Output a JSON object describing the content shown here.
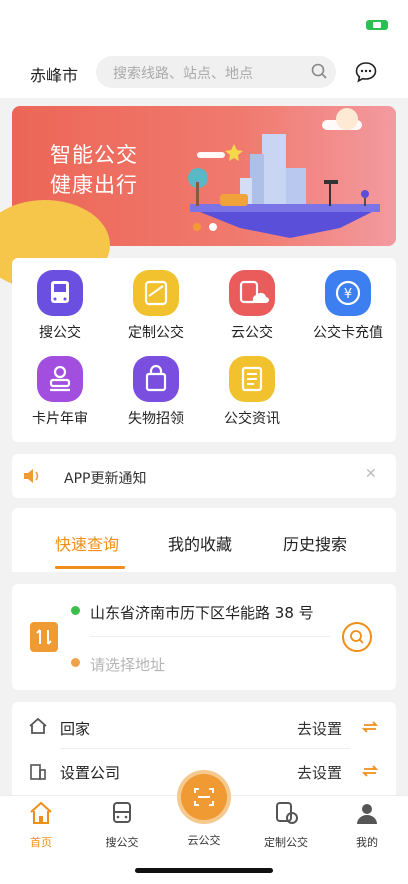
{
  "header": {
    "city": "赤峰市",
    "search_placeholder": "搜索线路、站点、地点"
  },
  "banner": {
    "line1": "智能公交",
    "line2": "健康出行"
  },
  "features": [
    {
      "label": "搜公交",
      "icon": "bus-icon",
      "color": "#6b4fe0"
    },
    {
      "label": "定制公交",
      "icon": "custom-bus-icon",
      "color": "#f2c12e"
    },
    {
      "label": "云公交",
      "icon": "cloud-bus-icon",
      "color": "#ea5b5b"
    },
    {
      "label": "公交卡充值",
      "icon": "card-recharge-icon",
      "color": "#3d7ff0"
    },
    {
      "label": "卡片年审",
      "icon": "stamp-icon",
      "color": "#a24fe0"
    },
    {
      "label": "失物招领",
      "icon": "lost-found-bag-icon",
      "color": "#7a4fe0"
    },
    {
      "label": "公交资讯",
      "icon": "news-icon",
      "color": "#f2c12e"
    }
  ],
  "notice": {
    "text": "APP更新通知"
  },
  "tabs": [
    {
      "label": "快速查询",
      "active": true
    },
    {
      "label": "我的收藏",
      "active": false
    },
    {
      "label": "历史搜索",
      "active": false
    }
  ],
  "route": {
    "from": "山东省济南市历下区华能路 38 号",
    "to_placeholder": "请选择地址"
  },
  "shortcuts": [
    {
      "label": "回家",
      "action": "去设置",
      "icon": "home-icon"
    },
    {
      "label": "设置公司",
      "action": "去设置",
      "icon": "building-icon"
    }
  ],
  "tabbar": [
    {
      "label": "首页",
      "icon": "home-tab-icon",
      "active": true
    },
    {
      "label": "搜公交",
      "icon": "bus-tab-icon",
      "active": false
    },
    {
      "label": "云公交",
      "icon": "scan-icon",
      "active": false
    },
    {
      "label": "定制公交",
      "icon": "custom-bus-tab-icon",
      "active": false
    },
    {
      "label": "我的",
      "icon": "profile-icon",
      "active": false
    }
  ],
  "colors": {
    "accent": "#ef8f1a",
    "banner": "#ec6657"
  }
}
